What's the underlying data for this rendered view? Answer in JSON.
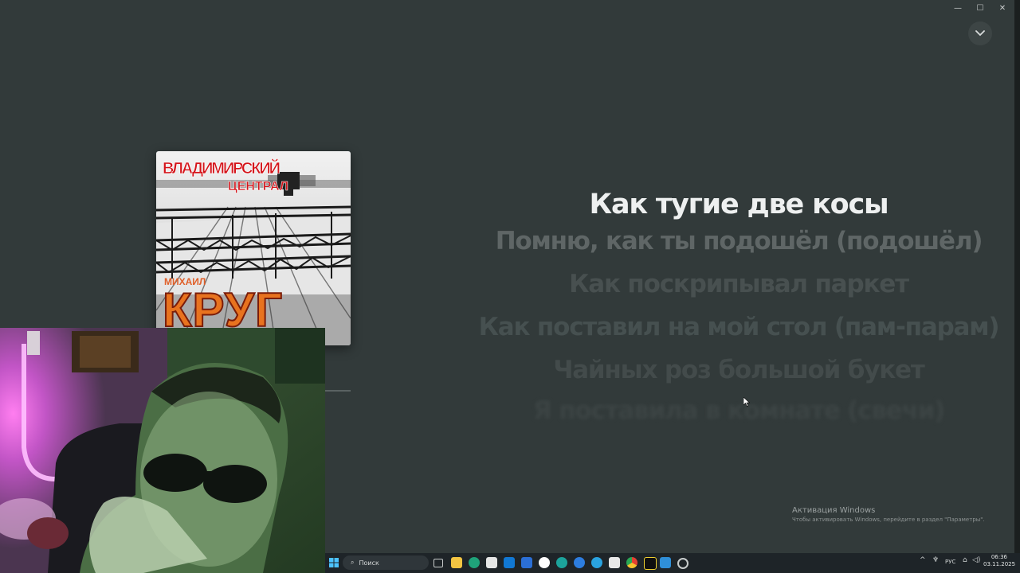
{
  "window": {
    "minimize_glyph": "—",
    "maximize_glyph": "☐",
    "close_glyph": "✕",
    "collapse_icon": "chevron-down-icon"
  },
  "album": {
    "title_line1": "ВЛАДИМИРСКИЙ",
    "title_line2": "ЦЕНТРАЛ",
    "artist_first": "МИХАИЛ",
    "artist_last": "КРУГ"
  },
  "lyrics": {
    "active": "Как тугие две косы",
    "lines": [
      "Помню, как ты подошёл (подошёл)",
      "Как поскрипывал паркет",
      "Как поставил на мой стол (пам-парам)",
      "Чайных роз большой букет",
      "Я поставила в комнате (свечи)"
    ]
  },
  "activation": {
    "title": "Активация Windows",
    "subtitle": "Чтобы активировать Windows, перейдите в раздел \"Параметры\"."
  },
  "taskbar": {
    "search_placeholder": "Поиск",
    "language": "РУС",
    "time": "06:36",
    "date": "03.11.2025"
  },
  "colors": {
    "background": "#323a3a",
    "lyric_active": "#eef0f0",
    "lyric_inactive": "#5b6262",
    "taskbar": "#1e2428"
  }
}
